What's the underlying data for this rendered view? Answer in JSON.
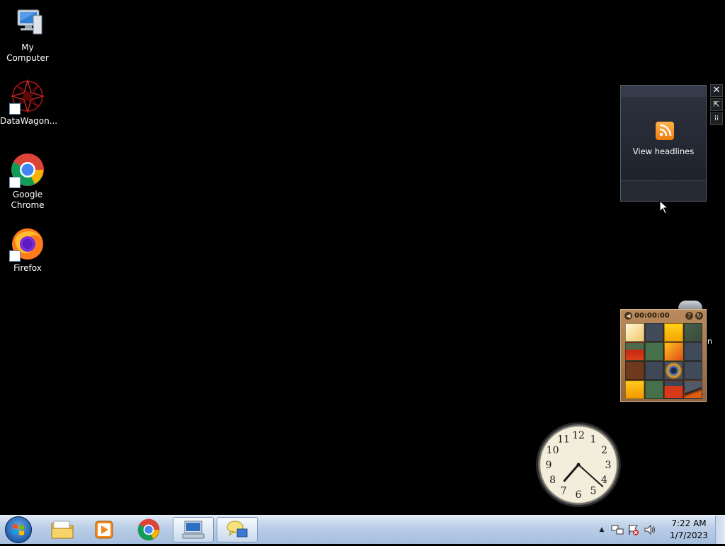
{
  "desktop": {
    "icons": [
      {
        "label": "My Computer",
        "icon": "computer-icon"
      },
      {
        "label": "DataWagon...",
        "icon": "datawagon-icon"
      },
      {
        "label": "Google Chrome",
        "icon": "chrome-icon"
      },
      {
        "label": "Firefox",
        "icon": "firefox-icon"
      }
    ]
  },
  "gadgets": {
    "rss": {
      "label": "View headlines",
      "icon": "rss-feed-icon"
    },
    "puzzle": {
      "timer": "00:00:00"
    },
    "clock": {
      "numerals": [
        "12",
        "1",
        "2",
        "3",
        "4",
        "5",
        "6",
        "7",
        "8",
        "9",
        "10",
        "11"
      ],
      "time": "7:22"
    },
    "stub_text": "n"
  },
  "taskbar": {
    "start_icon": "windows-start-icon",
    "pinned": [
      "file-explorer-icon",
      "media-player-icon",
      "chrome-icon",
      "remote-desktop-icon",
      "chat-icon"
    ],
    "tray_icons": [
      "show-hidden-icons-chevron",
      "network-icon",
      "action-center-icon",
      "volume-icon"
    ],
    "time": "7:22 AM",
    "date": "1/7/2023"
  },
  "colors": {
    "desktop": "#000000",
    "taskbar": "#b9cde6",
    "rss_accent": "#f28a1c"
  }
}
